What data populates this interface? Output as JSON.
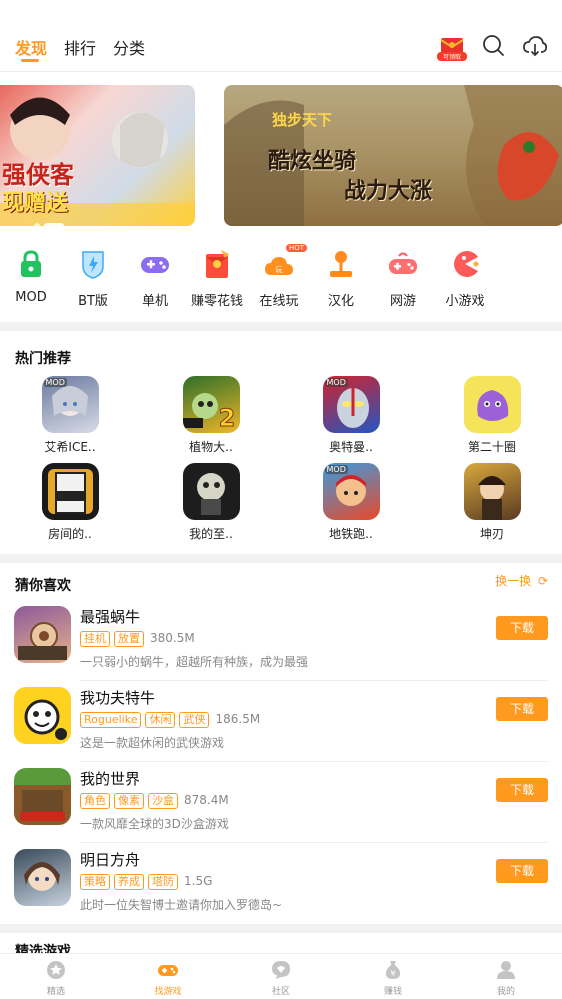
{
  "header": {
    "tabs": [
      {
        "label": "发现",
        "active": true
      },
      {
        "label": "排行",
        "active": false
      },
      {
        "label": "分类",
        "active": false
      }
    ],
    "icons": [
      "red-envelope-icon",
      "search-icon",
      "download-icon"
    ],
    "red_envelope_badge": "可领取"
  },
  "banners": [
    {
      "id": "left",
      "lines": [
        "强侠客",
        "现赠送"
      ]
    },
    {
      "id": "right",
      "lines": [
        "独步天下",
        "酷炫坐骑",
        "战力大涨"
      ]
    }
  ],
  "categories": [
    {
      "label": "MOD",
      "icon": "lock-icon",
      "color": "#22c35e"
    },
    {
      "label": "BT版",
      "icon": "bt-shield-icon",
      "color": "#3fa9f5"
    },
    {
      "label": "单机",
      "icon": "gamepad-icon",
      "color": "#8c6cf0"
    },
    {
      "label": "赚零花钱",
      "icon": "red-packet-icon",
      "color": "#ff4b3a"
    },
    {
      "label": "在线玩",
      "icon": "cloud-play-icon",
      "color": "#ff8f1f",
      "badge": "HOT"
    },
    {
      "label": "汉化",
      "icon": "joystick-icon",
      "color": "#ff8a1e"
    },
    {
      "label": "网游",
      "icon": "controller-icon",
      "color": "#ff5a5a"
    },
    {
      "label": "小游戏",
      "icon": "pacman-icon",
      "color": "#ff5a5a"
    }
  ],
  "hot": {
    "title": "热门推荐",
    "apps": [
      {
        "name": "艾希ICE..",
        "mod": true,
        "colors": [
          "#6b7aa0",
          "#d8dbe6"
        ]
      },
      {
        "name": "植物大..",
        "mod": false,
        "colors": [
          "#2e6f2a",
          "#f0b728"
        ]
      },
      {
        "name": "奥特曼..",
        "mod": true,
        "colors": [
          "#d0232c",
          "#2456c2"
        ]
      },
      {
        "name": "第二十圈",
        "mod": false,
        "colors": [
          "#f5e35a",
          "#9a62d6"
        ]
      },
      {
        "name": "房间的..",
        "mod": false,
        "colors": [
          "#f1f1f1",
          "#e7a72b"
        ]
      },
      {
        "name": "我的至..",
        "mod": false,
        "colors": [
          "#1d1d1d",
          "#8a8a8a"
        ]
      },
      {
        "name": "地铁跑..",
        "mod": true,
        "colors": [
          "#e9492a",
          "#3a9be0"
        ]
      },
      {
        "name": "坤刃",
        "mod": false,
        "colors": [
          "#d8a83c",
          "#5a3a23"
        ]
      }
    ]
  },
  "guess": {
    "title": "猜你喜欢",
    "refresh_label": "换一换",
    "download_label": "下载",
    "items": [
      {
        "name": "最强蜗牛",
        "tags": [
          "挂机",
          "放置"
        ],
        "size": "380.5M",
        "desc": "一只弱小的蜗牛，超越所有种族，成为最强",
        "colors": [
          "#8d5a9a",
          "#e7b38c"
        ]
      },
      {
        "name": "我功夫特牛",
        "tags": [
          "Roguelike",
          "休闲",
          "武侠"
        ],
        "size": "186.5M",
        "desc": "这是一款超休闲的武侠游戏",
        "colors": [
          "#ffd21f",
          "#222222"
        ]
      },
      {
        "name": "我的世界",
        "tags": [
          "角色",
          "像素",
          "沙盒"
        ],
        "size": "878.4M",
        "desc": "一款风靡全球的3D沙盒游戏",
        "colors": [
          "#5a9a3a",
          "#8a5a2a"
        ]
      },
      {
        "name": "明日方舟",
        "tags": [
          "策略",
          "养成",
          "塔防"
        ],
        "size": "1.5G",
        "desc": "此时一位失智博士邀请你加入罗德岛~",
        "colors": [
          "#3a4a5a",
          "#c7d3df"
        ]
      }
    ]
  },
  "next_section_title": "精选游戏",
  "bottom_nav": [
    {
      "label": "精选",
      "icon": "star-circle-icon",
      "active": false
    },
    {
      "label": "找游戏",
      "icon": "gamepad-nav-icon",
      "active": true
    },
    {
      "label": "社区",
      "icon": "chat-bubble-icon",
      "active": false
    },
    {
      "label": "赚钱",
      "icon": "money-bag-icon",
      "active": false
    },
    {
      "label": "我的",
      "icon": "user-icon",
      "active": false
    }
  ]
}
